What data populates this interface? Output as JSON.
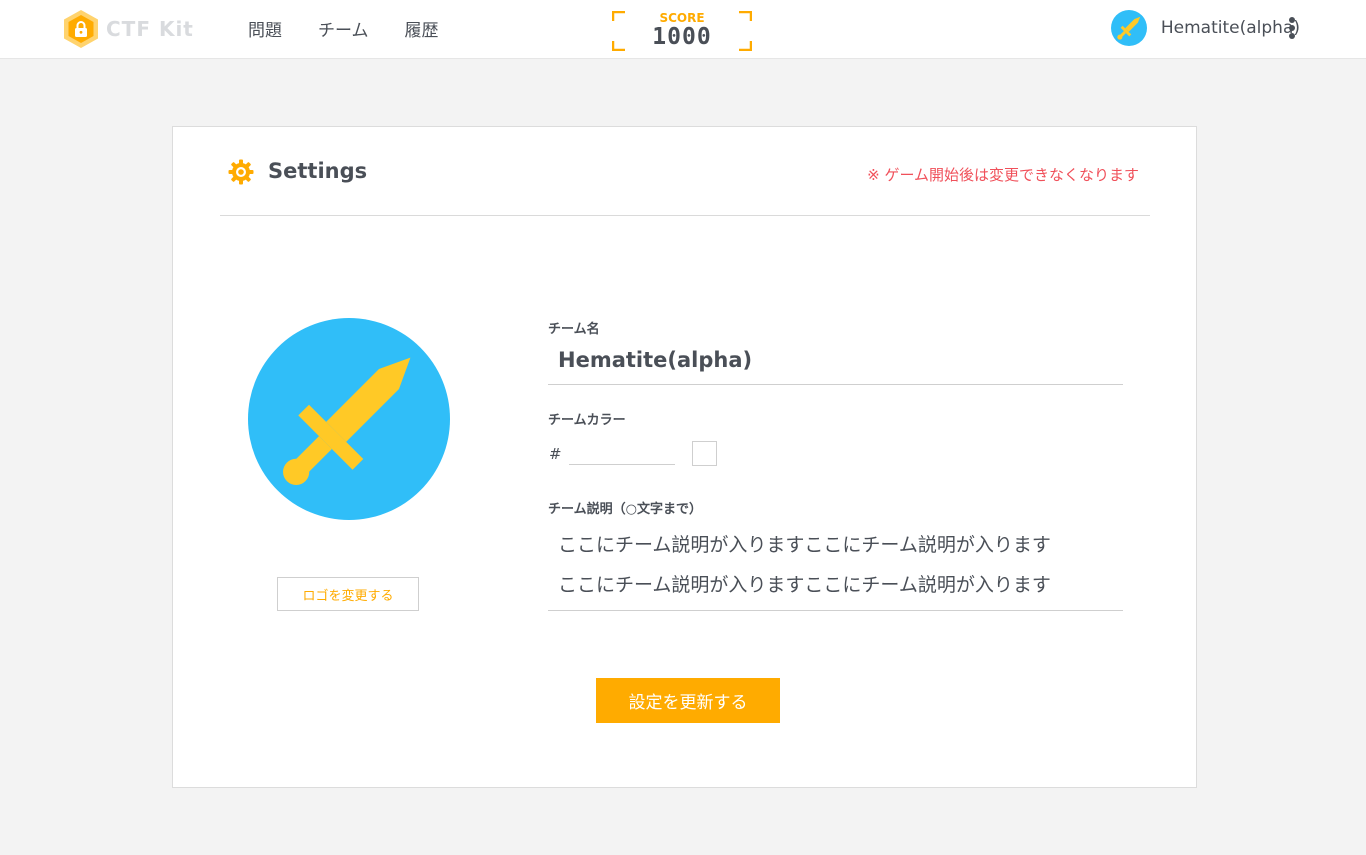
{
  "header": {
    "logo_text": "CTF Kit",
    "nav": [
      "問題",
      "チーム",
      "履歴"
    ],
    "score": {
      "label": "SCORE",
      "value": "1000"
    },
    "user": {
      "name": "Hematite(alpha)"
    }
  },
  "settings": {
    "title": "Settings",
    "notice": "※ ゲーム開始後は変更できなくなります",
    "logo_change_label": "ロゴを変更する",
    "team_name_label": "チーム名",
    "team_name_value": "Hematite(alpha)",
    "team_color_label": "チームカラー",
    "hash_symbol": "#",
    "team_color_value": "",
    "description_label": "チーム説明（○文字まで）",
    "description_lines": [
      "ここにチーム説明が入りますここにチーム説明が入ります",
      "ここにチーム説明が入りますここにチーム説明が入ります"
    ],
    "submit_label": "設定を更新する"
  },
  "colors": {
    "accent": "#ffab00",
    "avatar_bg": "#30bef8",
    "sword": "#ffc926",
    "notice": "#f0505a"
  },
  "icons": {
    "logo": "hexagon-lock-icon",
    "avatar": "sword-icon",
    "settings": "gear-icon",
    "menu": "more-vertical-icon"
  }
}
